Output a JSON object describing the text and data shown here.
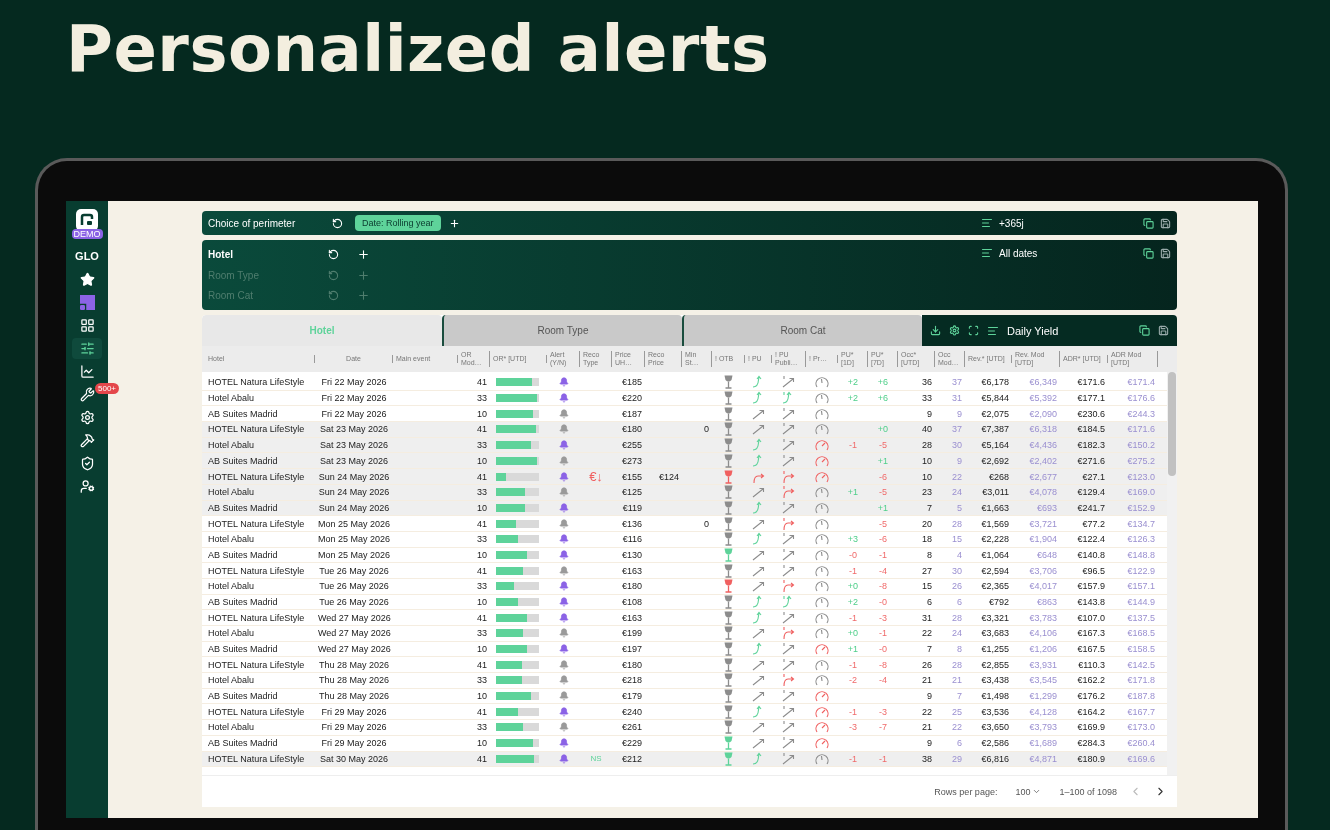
{
  "headline": "Personalized alerts",
  "sidebar": {
    "badge": "DEMO",
    "scope": "GLO",
    "nav": [
      {
        "selected": false
      },
      {
        "selected": false
      },
      {
        "selected": false
      },
      {
        "selected": true
      },
      {
        "selected": false
      },
      {
        "selected": false,
        "badge": "500+"
      },
      {
        "selected": false
      },
      {
        "selected": false
      },
      {
        "selected": false
      },
      {
        "selected": false
      }
    ]
  },
  "perimeter": {
    "label": "Choice of perimeter",
    "chip": "Date: Rolling year",
    "range": "+365j"
  },
  "dimensions": {
    "items": [
      {
        "label": "Hotel",
        "disabled": false
      },
      {
        "label": "Room Type",
        "disabled": true
      },
      {
        "label": "Room Cat",
        "disabled": true
      }
    ],
    "dates": "All dates"
  },
  "tabs": [
    {
      "label": "Hotel",
      "selected": true
    },
    {
      "label": "Room Type",
      "selected": false
    },
    {
      "label": "Room Cat",
      "selected": false
    }
  ],
  "view": "Daily Yield",
  "columns": [
    "Hotel",
    "Date",
    "Main event",
    "OR Mod…",
    "OR* [UTD]",
    "Alert (Y/N)",
    "Reco Type",
    "Price UH…",
    "Reco Price",
    "Min St…",
    "! OTB",
    "! PU",
    "! PU Publi…",
    "! Pr…",
    "PU* [1D]",
    "PU* [7D]",
    "Occ* [UTD]",
    "Occ Mod…",
    "Rev.* [UTD]",
    "Rev. Mod [UTD]",
    "ADR* [UTD]",
    "ADR Mod [UTD]"
  ],
  "rows": [
    {
      "hotel": "HOTEL Natura LifeStyle",
      "date": "Fri 22 May 2026",
      "or_mod": "41",
      "level": 0.88,
      "alert": true,
      "price": "€185",
      "indicators": [
        {
          "kind": "neutral"
        },
        {
          "kind": "good"
        },
        {
          "kind": "neutral"
        },
        {
          "kind": "neutral"
        }
      ],
      "pu_1d": "+2",
      "pu_1d_up": true,
      "pu_7d": "+6",
      "pu_7d_up": true,
      "occ": "36",
      "occ_mod": "37",
      "rev": "€6,178",
      "rev_mod": "€6,349",
      "adr": "€171.6",
      "adr_mod": "€171.4",
      "highlighted": false
    },
    {
      "hotel": "Hotel Abalu",
      "date": "Fri 22 May 2026",
      "or_mod": "33",
      "level": 1,
      "alert": true,
      "price": "€220",
      "indicators": [
        {
          "kind": "neutral"
        },
        {
          "kind": "good"
        },
        {
          "kind": "good"
        },
        {
          "kind": "neutral"
        }
      ],
      "pu_1d": "+2",
      "pu_1d_up": true,
      "pu_7d": "+6",
      "pu_7d_up": true,
      "occ": "33",
      "occ_mod": "31",
      "rev": "€5,844",
      "rev_mod": "€5,392",
      "adr": "€177.1",
      "adr_mod": "€176.6",
      "highlighted": false
    },
    {
      "hotel": "AB Suites Madrid",
      "date": "Fri 22 May 2026",
      "or_mod": "10",
      "level": 0.92,
      "alert": false,
      "price": "€187",
      "indicators": [
        {
          "kind": "neutral"
        },
        {
          "kind": "neutral"
        },
        {
          "kind": "neutral"
        },
        {
          "kind": "neutral"
        }
      ],
      "occ": "9",
      "occ_mod": "9",
      "rev": "€2,075",
      "rev_mod": "€2,090",
      "adr": "€230.6",
      "adr_mod": "€244.3",
      "highlighted": false
    },
    {
      "hotel": "HOTEL Natura LifeStyle",
      "date": "Sat 23 May 2026",
      "or_mod": "41",
      "level": 0.98,
      "alert": false,
      "price": "€180",
      "min_stay": "0",
      "indicators": [
        {
          "kind": "neutral"
        },
        {
          "kind": "neutral"
        },
        {
          "kind": "neutral"
        },
        {
          "kind": "neutral"
        }
      ],
      "pu_7d": "+0",
      "pu_7d_up": true,
      "occ": "40",
      "occ_mod": "37",
      "rev": "€7,387",
      "rev_mod": "€6,318",
      "adr": "€184.5",
      "adr_mod": "€171.6",
      "highlighted": true
    },
    {
      "hotel": "Hotel Abalu",
      "date": "Sat 23 May 2026",
      "or_mod": "33",
      "level": 0.87,
      "alert": true,
      "price": "€255",
      "indicators": [
        {
          "kind": "neutral"
        },
        {
          "kind": "good"
        },
        {
          "kind": "neutral"
        },
        {
          "kind": "alert"
        }
      ],
      "pu_1d": "-1",
      "pu_1d_up": false,
      "pu_7d": "-5",
      "pu_7d_up": false,
      "occ": "28",
      "occ_mod": "30",
      "rev": "€5,164",
      "rev_mod": "€4,436",
      "adr": "€182.3",
      "adr_mod": "€150.2",
      "highlighted": true
    },
    {
      "hotel": "AB Suites Madrid",
      "date": "Sat 23 May 2026",
      "or_mod": "10",
      "level": 1,
      "alert": false,
      "price": "€273",
      "indicators": [
        {
          "kind": "neutral"
        },
        {
          "kind": "good"
        },
        {
          "kind": "neutral"
        },
        {
          "kind": "alert"
        }
      ],
      "pu_7d": "+1",
      "pu_7d_up": true,
      "occ": "10",
      "occ_mod": "9",
      "rev": "€2,692",
      "rev_mod": "€2,402",
      "adr": "€271.6",
      "adr_mod": "€275.2",
      "highlighted": true
    },
    {
      "hotel": "HOTEL Natura LifeStyle",
      "date": "Sun 24 May 2026",
      "or_mod": "41",
      "level": 0.25,
      "alert": true,
      "reco": {
        "text": "€↓",
        "kind": "alert"
      },
      "price": "€155",
      "reco_price": "€124",
      "indicators": [
        {
          "kind": "alert"
        },
        {
          "kind": "alert"
        },
        {
          "kind": "alert"
        },
        {
          "kind": "alert"
        }
      ],
      "pu_7d": "-6",
      "pu_7d_up": false,
      "occ": "10",
      "occ_mod": "22",
      "rev": "€268",
      "rev_mod": "€2,677",
      "adr": "€27.1",
      "adr_mod": "€123.0",
      "highlighted": true
    },
    {
      "hotel": "Hotel Abalu",
      "date": "Sun 24 May 2026",
      "or_mod": "33",
      "level": 0.72,
      "alert": false,
      "price": "€125",
      "indicators": [
        {
          "kind": "neutral"
        },
        {
          "kind": "neutral"
        },
        {
          "kind": "alert"
        },
        {
          "kind": "neutral"
        }
      ],
      "pu_1d": "+1",
      "pu_1d_up": true,
      "pu_7d": "-5",
      "pu_7d_up": false,
      "occ": "23",
      "occ_mod": "24",
      "rev": "€3,011",
      "rev_mod": "€4,078",
      "adr": "€129.4",
      "adr_mod": "€169.0",
      "highlighted": true
    },
    {
      "hotel": "AB Suites Madrid",
      "date": "Sun 24 May 2026",
      "or_mod": "10",
      "level": 0.7,
      "alert": true,
      "price": "€119",
      "indicators": [
        {
          "kind": "neutral"
        },
        {
          "kind": "good"
        },
        {
          "kind": "neutral"
        },
        {
          "kind": "neutral"
        }
      ],
      "pu_7d": "+1",
      "pu_7d_up": true,
      "occ": "7",
      "occ_mod": "5",
      "rev": "€1,663",
      "rev_mod": "€693",
      "adr": "€241.7",
      "adr_mod": "€152.9",
      "highlighted": true
    },
    {
      "hotel": "HOTEL Natura LifeStyle",
      "date": "Mon 25 May 2026",
      "or_mod": "41",
      "level": 0.5,
      "alert": false,
      "price": "€136",
      "min_stay": "0",
      "indicators": [
        {
          "kind": "neutral"
        },
        {
          "kind": "neutral"
        },
        {
          "kind": "alert"
        },
        {
          "kind": "neutral"
        }
      ],
      "pu_7d": "-5",
      "pu_7d_up": false,
      "occ": "20",
      "occ_mod": "28",
      "rev": "€1,569",
      "rev_mod": "€3,721",
      "adr": "€77.2",
      "adr_mod": "€134.7",
      "highlighted": false
    },
    {
      "hotel": "Hotel Abalu",
      "date": "Mon 25 May 2026",
      "or_mod": "33",
      "level": 0.55,
      "alert": true,
      "price": "€116",
      "indicators": [
        {
          "kind": "neutral"
        },
        {
          "kind": "good"
        },
        {
          "kind": "neutral"
        },
        {
          "kind": "neutral"
        }
      ],
      "pu_1d": "+3",
      "pu_1d_up": true,
      "pu_7d": "-6",
      "pu_7d_up": false,
      "occ": "18",
      "occ_mod": "15",
      "rev": "€2,228",
      "rev_mod": "€1,904",
      "adr": "€122.4",
      "adr_mod": "€126.3",
      "highlighted": false
    },
    {
      "hotel": "AB Suites Madrid",
      "date": "Mon 25 May 2026",
      "or_mod": "10",
      "level": 0.76,
      "alert": true,
      "price": "€130",
      "indicators": [
        {
          "kind": "good"
        },
        {
          "kind": "neutral"
        },
        {
          "kind": "neutral"
        },
        {
          "kind": "neutral"
        }
      ],
      "pu_1d": "-0",
      "pu_1d_up": false,
      "pu_7d": "-1",
      "pu_7d_up": false,
      "occ": "8",
      "occ_mod": "4",
      "rev": "€1,064",
      "rev_mod": "€648",
      "adr": "€140.8",
      "adr_mod": "€148.8",
      "highlighted": false
    },
    {
      "hotel": "HOTEL Natura LifeStyle",
      "date": "Tue 26 May 2026",
      "or_mod": "41",
      "level": 0.66,
      "alert": false,
      "price": "€163",
      "indicators": [
        {
          "kind": "neutral"
        },
        {
          "kind": "neutral"
        },
        {
          "kind": "neutral"
        },
        {
          "kind": "neutral"
        }
      ],
      "pu_1d": "-1",
      "pu_1d_up": false,
      "pu_7d": "-4",
      "pu_7d_up": false,
      "occ": "27",
      "occ_mod": "30",
      "rev": "€2,594",
      "rev_mod": "€3,706",
      "adr": "€96.5",
      "adr_mod": "€122.9",
      "highlighted": false
    },
    {
      "hotel": "Hotel Abalu",
      "date": "Tue 26 May 2026",
      "or_mod": "33",
      "level": 0.45,
      "alert": true,
      "price": "€180",
      "indicators": [
        {
          "kind": "alert"
        },
        {
          "kind": "neutral"
        },
        {
          "kind": "alert"
        },
        {
          "kind": "neutral"
        }
      ],
      "pu_1d": "+0",
      "pu_1d_up": true,
      "pu_7d": "-8",
      "pu_7d_up": false,
      "occ": "15",
      "occ_mod": "26",
      "rev": "€2,365",
      "rev_mod": "€4,017",
      "adr": "€157.9",
      "adr_mod": "€157.1",
      "highlighted": false
    },
    {
      "hotel": "AB Suites Madrid",
      "date": "Tue 26 May 2026",
      "or_mod": "10",
      "level": 0.55,
      "alert": true,
      "price": "€108",
      "indicators": [
        {
          "kind": "neutral"
        },
        {
          "kind": "good"
        },
        {
          "kind": "good"
        },
        {
          "kind": "neutral"
        }
      ],
      "pu_1d": "+2",
      "pu_1d_up": true,
      "pu_7d": "-0",
      "pu_7d_up": false,
      "occ": "6",
      "occ_mod": "6",
      "rev": "€792",
      "rev_mod": "€863",
      "adr": "€143.8",
      "adr_mod": "€144.9",
      "highlighted": false
    },
    {
      "hotel": "HOTEL Natura LifeStyle",
      "date": "Wed 27 May 2026",
      "or_mod": "41",
      "level": 0.77,
      "alert": true,
      "price": "€163",
      "indicators": [
        {
          "kind": "neutral"
        },
        {
          "kind": "good"
        },
        {
          "kind": "neutral"
        },
        {
          "kind": "neutral"
        }
      ],
      "pu_1d": "-1",
      "pu_1d_up": false,
      "pu_7d": "-3",
      "pu_7d_up": false,
      "occ": "31",
      "occ_mod": "28",
      "rev": "€3,321",
      "rev_mod": "€3,783",
      "adr": "€107.0",
      "adr_mod": "€137.5",
      "highlighted": false
    },
    {
      "hotel": "Hotel Abalu",
      "date": "Wed 27 May 2026",
      "or_mod": "33",
      "level": 0.67,
      "alert": false,
      "price": "€199",
      "indicators": [
        {
          "kind": "neutral"
        },
        {
          "kind": "neutral"
        },
        {
          "kind": "alert"
        },
        {
          "kind": "neutral"
        }
      ],
      "pu_1d": "+0",
      "pu_1d_up": true,
      "pu_7d": "-1",
      "pu_7d_up": false,
      "occ": "22",
      "occ_mod": "24",
      "rev": "€3,683",
      "rev_mod": "€4,106",
      "adr": "€167.3",
      "adr_mod": "€168.5",
      "highlighted": false
    },
    {
      "hotel": "AB Suites Madrid",
      "date": "Wed 27 May 2026",
      "or_mod": "10",
      "level": 0.76,
      "alert": true,
      "price": "€197",
      "indicators": [
        {
          "kind": "neutral"
        },
        {
          "kind": "good"
        },
        {
          "kind": "neutral"
        },
        {
          "kind": "alert"
        }
      ],
      "pu_1d": "+1",
      "pu_1d_up": true,
      "pu_7d": "-0",
      "pu_7d_up": false,
      "occ": "7",
      "occ_mod": "8",
      "rev": "€1,255",
      "rev_mod": "€1,206",
      "adr": "€167.5",
      "adr_mod": "€158.5",
      "highlighted": false
    },
    {
      "hotel": "HOTEL Natura LifeStyle",
      "date": "Thu 28 May 2026",
      "or_mod": "41",
      "level": 0.64,
      "alert": false,
      "price": "€180",
      "indicators": [
        {
          "kind": "neutral"
        },
        {
          "kind": "neutral"
        },
        {
          "kind": "neutral"
        },
        {
          "kind": "neutral"
        }
      ],
      "pu_1d": "-1",
      "pu_1d_up": false,
      "pu_7d": "-8",
      "pu_7d_up": false,
      "occ": "26",
      "occ_mod": "28",
      "rev": "€2,855",
      "rev_mod": "€3,931",
      "adr": "€110.3",
      "adr_mod": "€142.5",
      "highlighted": false
    },
    {
      "hotel": "Hotel Abalu",
      "date": "Thu 28 May 2026",
      "or_mod": "33",
      "level": 0.65,
      "alert": false,
      "price": "€218",
      "indicators": [
        {
          "kind": "neutral"
        },
        {
          "kind": "neutral"
        },
        {
          "kind": "alert"
        },
        {
          "kind": "neutral"
        }
      ],
      "pu_1d": "-2",
      "pu_1d_up": false,
      "pu_7d": "-4",
      "pu_7d_up": false,
      "occ": "21",
      "occ_mod": "21",
      "rev": "€3,438",
      "rev_mod": "€3,545",
      "adr": "€162.2",
      "adr_mod": "€171.8",
      "highlighted": false
    },
    {
      "hotel": "AB Suites Madrid",
      "date": "Thu 28 May 2026",
      "or_mod": "10",
      "level": 0.86,
      "alert": false,
      "price": "€179",
      "indicators": [
        {
          "kind": "neutral"
        },
        {
          "kind": "neutral"
        },
        {
          "kind": "neutral"
        },
        {
          "kind": "alert"
        }
      ],
      "occ": "9",
      "occ_mod": "7",
      "rev": "€1,498",
      "rev_mod": "€1,299",
      "adr": "€176.2",
      "adr_mod": "€187.8",
      "highlighted": false
    },
    {
      "hotel": "HOTEL Natura LifeStyle",
      "date": "Fri 29 May 2026",
      "or_mod": "41",
      "level": 0.53,
      "alert": true,
      "price": "€240",
      "indicators": [
        {
          "kind": "neutral"
        },
        {
          "kind": "good"
        },
        {
          "kind": "neutral"
        },
        {
          "kind": "alert"
        }
      ],
      "pu_1d": "-1",
      "pu_1d_up": false,
      "pu_7d": "-3",
      "pu_7d_up": false,
      "occ": "22",
      "occ_mod": "25",
      "rev": "€3,536",
      "rev_mod": "€4,128",
      "adr": "€164.2",
      "adr_mod": "€167.7",
      "highlighted": false
    },
    {
      "hotel": "Hotel Abalu",
      "date": "Fri 29 May 2026",
      "or_mod": "33",
      "level": 0.66,
      "alert": false,
      "price": "€261",
      "indicators": [
        {
          "kind": "neutral"
        },
        {
          "kind": "neutral"
        },
        {
          "kind": "neutral"
        },
        {
          "kind": "alert"
        }
      ],
      "pu_1d": "-3",
      "pu_1d_up": false,
      "pu_7d": "-7",
      "pu_7d_up": false,
      "occ": "21",
      "occ_mod": "22",
      "rev": "€3,650",
      "rev_mod": "€3,793",
      "adr": "€169.9",
      "adr_mod": "€173.0",
      "highlighted": false
    },
    {
      "hotel": "AB Suites Madrid",
      "date": "Fri 29 May 2026",
      "or_mod": "10",
      "level": 0.92,
      "alert": true,
      "price": "€229",
      "indicators": [
        {
          "kind": "good"
        },
        {
          "kind": "neutral"
        },
        {
          "kind": "neutral"
        },
        {
          "kind": "alert"
        }
      ],
      "occ": "9",
      "occ_mod": "6",
      "rev": "€2,586",
      "rev_mod": "€1,689",
      "adr": "€284.3",
      "adr_mod": "€260.4",
      "highlighted": false
    },
    {
      "hotel": "HOTEL Natura LifeStyle",
      "date": "Sat 30 May 2026",
      "or_mod": "41",
      "level": 0.93,
      "alert": true,
      "reco": {
        "text": "NS",
        "kind": "good"
      },
      "price": "€212",
      "indicators": [
        {
          "kind": "good"
        },
        {
          "kind": "good"
        },
        {
          "kind": "neutral"
        },
        {
          "kind": "neutral"
        }
      ],
      "pu_1d": "-1",
      "pu_1d_up": false,
      "pu_7d": "-1",
      "pu_7d_up": false,
      "occ": "38",
      "occ_mod": "29",
      "rev": "€6,816",
      "rev_mod": "€4,871",
      "adr": "€180.9",
      "adr_mod": "€169.6",
      "highlighted": true
    }
  ],
  "footer": {
    "rows_per_page_label": "Rows per page:",
    "rows_per_page": "100",
    "range": "1–100 of 1098",
    "prev_disabled": true,
    "next_disabled": false
  }
}
